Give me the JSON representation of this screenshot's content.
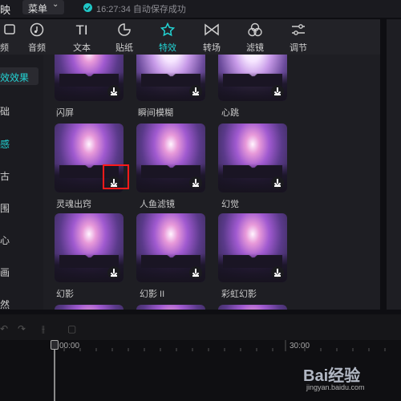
{
  "topbar": {
    "app_name": "映",
    "menu_label": "菜单",
    "save_status": "16:27:34 自动保存成功"
  },
  "tabs": [
    {
      "label": "频",
      "icon": "video-icon"
    },
    {
      "label": "音频",
      "icon": "audio-icon"
    },
    {
      "label": "文本",
      "icon": "text-icon"
    },
    {
      "label": "贴纸",
      "icon": "sticker-icon"
    },
    {
      "label": "特效",
      "icon": "effects-icon",
      "active": true
    },
    {
      "label": "转场",
      "icon": "transition-icon"
    },
    {
      "label": "滤镜",
      "icon": "filter-icon"
    },
    {
      "label": "调节",
      "icon": "adjust-icon"
    }
  ],
  "categories": [
    {
      "label": "效效果",
      "active": true
    },
    {
      "label": "础"
    },
    {
      "label": "感",
      "accent": true
    },
    {
      "label": "古"
    },
    {
      "label": "围"
    },
    {
      "label": "心"
    },
    {
      "label": "画"
    },
    {
      "label": "然"
    }
  ],
  "effects": [
    {
      "name": "闪屏"
    },
    {
      "name": "瞬间模糊"
    },
    {
      "name": "心跳"
    },
    {
      "name": "灵魂出窍"
    },
    {
      "name": "人鱼滤镜"
    },
    {
      "name": "幻觉"
    },
    {
      "name": "幻影"
    },
    {
      "name": "幻影 II"
    },
    {
      "name": "彩虹幻影"
    }
  ],
  "timeline": {
    "time_start": "00:00",
    "time_mid": "30:00"
  },
  "watermark": {
    "brand": "Bai经验",
    "url": "jingyan.baidu.com"
  },
  "colors": {
    "accent": "#22d3d3",
    "highlight": "#ff1a1a"
  }
}
